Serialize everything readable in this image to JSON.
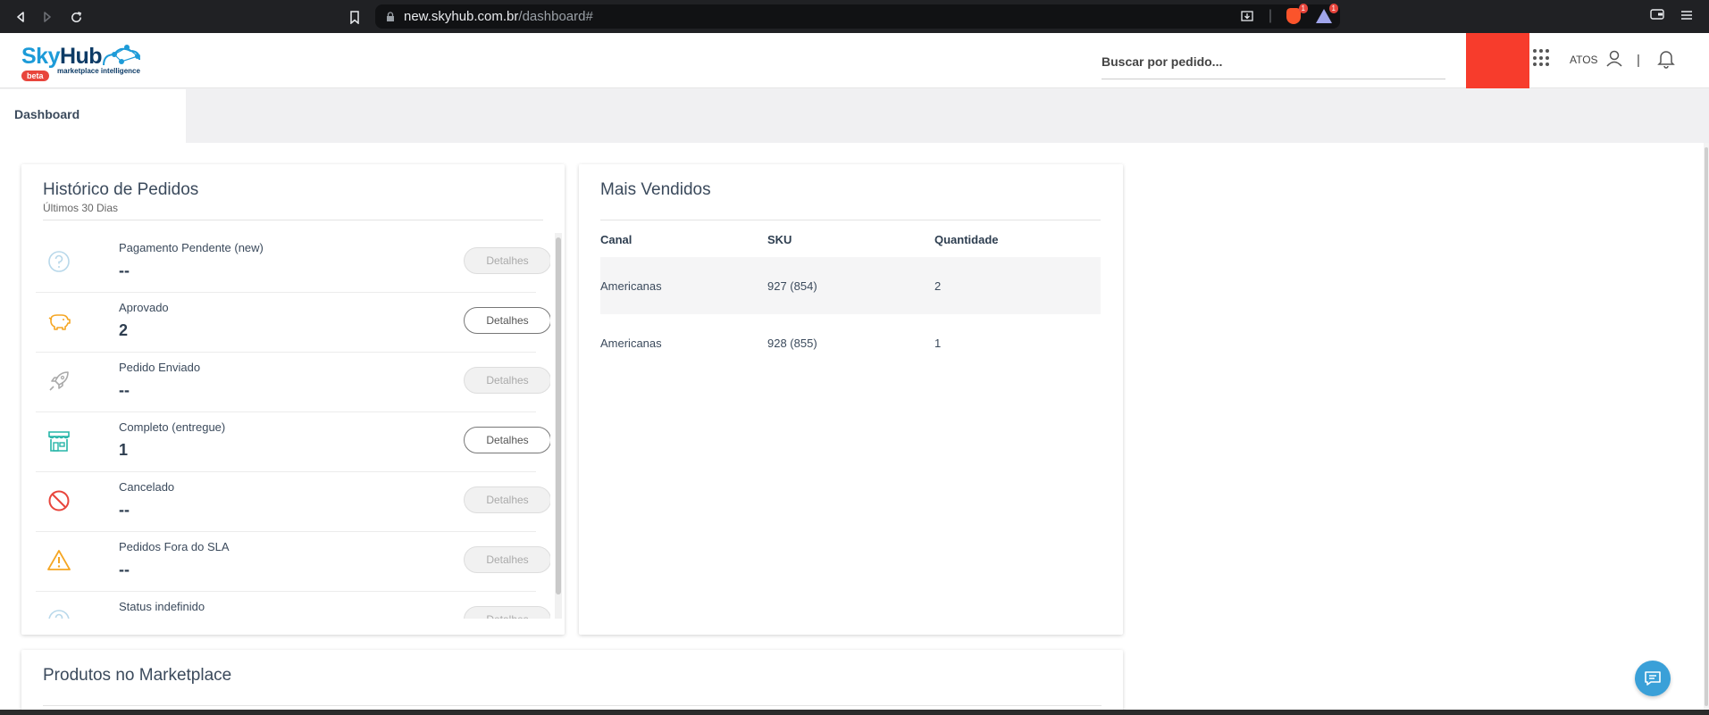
{
  "browser": {
    "url_host": "new.skyhub.com.br",
    "url_path": "/dashboard#",
    "ext_badge_brave": "1",
    "ext_badge_bat": "1"
  },
  "header": {
    "logo_sky": "Sky",
    "logo_hub": "Hub",
    "logo_sub": "marketplace intelligence",
    "logo_badge": "beta",
    "search_placeholder": "Buscar por pedido...",
    "user_label": "ATOS",
    "separator": "|"
  },
  "tabs": [
    {
      "label": "Dashboard"
    }
  ],
  "historico": {
    "title": "Histórico de Pedidos",
    "subtitle": "Últimos 30 Dias",
    "rows": [
      {
        "label": "Pagamento Pendente (new)",
        "value": "--",
        "button": "Detalhes",
        "icon": "question-icon",
        "enabled": false
      },
      {
        "label": "Aprovado",
        "value": "2",
        "button": "Detalhes",
        "icon": "piggy-bank-icon",
        "enabled": true
      },
      {
        "label": "Pedido Enviado",
        "value": "--",
        "button": "Detalhes",
        "icon": "rocket-icon",
        "enabled": false
      },
      {
        "label": "Completo (entregue)",
        "value": "1",
        "button": "Detalhes",
        "icon": "store-icon",
        "enabled": true
      },
      {
        "label": "Cancelado",
        "value": "--",
        "button": "Detalhes",
        "icon": "cancel-icon",
        "enabled": false
      },
      {
        "label": "Pedidos Fora do SLA",
        "value": "--",
        "button": "Detalhes",
        "icon": "warning-icon",
        "enabled": false
      },
      {
        "label": "Status indefinido",
        "value": "",
        "button": "Detalhes",
        "icon": "question-icon",
        "enabled": false
      }
    ]
  },
  "mais_vendidos": {
    "title": "Mais Vendidos",
    "columns": [
      "Canal",
      "SKU",
      "Quantidade"
    ],
    "rows": [
      [
        "Americanas",
        "927 (854)",
        "2"
      ],
      [
        "Americanas",
        "928 (855)",
        "1"
      ]
    ]
  },
  "produtos": {
    "title": "Produtos no Marketplace"
  },
  "colors": {
    "accent": "#1d9bd8",
    "brand_dark": "#0d3b66",
    "red_block": "#f73c2c",
    "piggy": "#f5a623",
    "store": "#26b5a8",
    "cancel": "#e8453c",
    "warning": "#f5a623"
  }
}
